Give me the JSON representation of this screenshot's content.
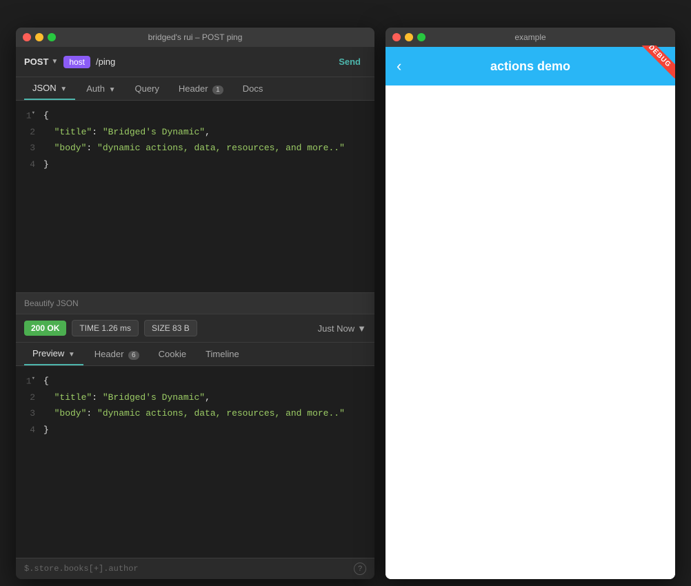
{
  "left_window": {
    "title": "bridged's rui – POST ping",
    "method": "POST",
    "host_label": "host",
    "url_path": "/ping",
    "send_label": "Send",
    "tabs": [
      {
        "id": "json",
        "label": "JSON",
        "active": true,
        "has_dropdown": true,
        "badge": null
      },
      {
        "id": "auth",
        "label": "Auth",
        "active": false,
        "has_dropdown": true,
        "badge": null
      },
      {
        "id": "query",
        "label": "Query",
        "active": false,
        "has_dropdown": false,
        "badge": null
      },
      {
        "id": "header",
        "label": "Header",
        "active": false,
        "has_dropdown": false,
        "badge": "1"
      },
      {
        "id": "docs",
        "label": "Docs",
        "active": false,
        "has_dropdown": false,
        "badge": null
      }
    ],
    "json_code": [
      {
        "line": 1,
        "has_toggle": true,
        "content": "{"
      },
      {
        "line": 2,
        "content": "  \"title\": \"Bridged's Dynamic\","
      },
      {
        "line": 3,
        "content": "  \"body\": \"dynamic actions, data, resources, and more..\""
      },
      {
        "line": 4,
        "content": "}"
      }
    ],
    "beautify_label": "Beautify JSON",
    "status": {
      "code": "200 OK",
      "time_label": "TIME 1.26 ms",
      "size_label": "SIZE 83 B",
      "timestamp": "Just Now"
    },
    "response_tabs": [
      {
        "id": "preview",
        "label": "Preview",
        "active": true,
        "has_dropdown": true,
        "badge": null
      },
      {
        "id": "header",
        "label": "Header",
        "active": false,
        "badge": "6"
      },
      {
        "id": "cookie",
        "label": "Cookie",
        "active": false,
        "badge": null
      },
      {
        "id": "timeline",
        "label": "Timeline",
        "active": false,
        "badge": null
      }
    ],
    "response_code": [
      {
        "line": 1,
        "has_toggle": true,
        "content": "{"
      },
      {
        "line": 2,
        "content": "  \"title\": \"Bridged's Dynamic\","
      },
      {
        "line": 3,
        "content": "  \"body\": \"dynamic actions, data, resources, and more..\""
      },
      {
        "line": 4,
        "content": "}"
      }
    ],
    "jsonpath_hint": "$.store.books[+].author",
    "help_icon": "?"
  },
  "right_window": {
    "title": "example",
    "header_title": "actions demo",
    "back_icon": "‹",
    "debug_label": "DEBUG"
  }
}
